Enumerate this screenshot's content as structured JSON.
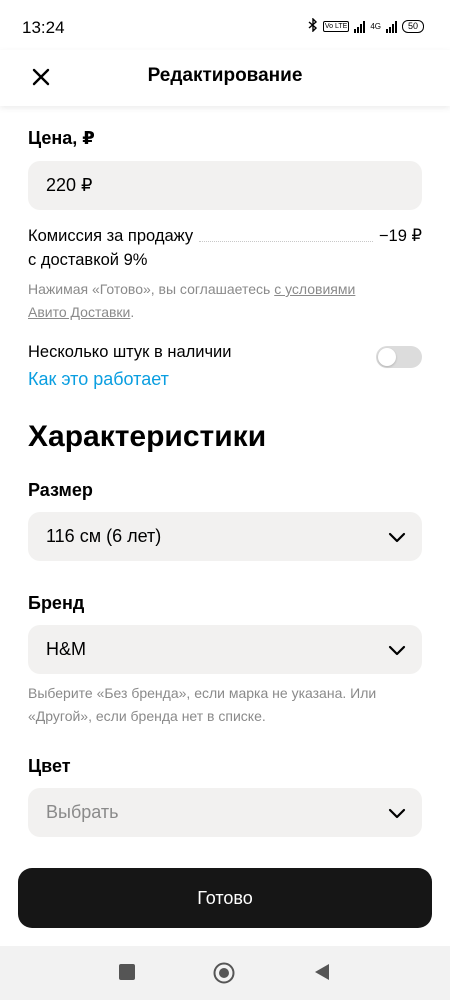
{
  "status_bar": {
    "time": "13:24",
    "lte_label": "Vo LTE",
    "network_label": "4G",
    "battery": "50"
  },
  "header": {
    "title": "Редактирование",
    "close_icon": "close-icon"
  },
  "price": {
    "label": "Цена, ₽",
    "value": "220 ₽"
  },
  "commission": {
    "label_line1": "Комиссия за продажу",
    "label_line2": "с доставкой 9%",
    "value": "−19 ₽"
  },
  "terms": {
    "prefix": "Нажимая «Готово», вы соглашаетесь ",
    "link1": "с условиями",
    "link2": "Авито Доставки",
    "suffix": "."
  },
  "multiple": {
    "label": "Несколько штук в наличии",
    "link": "Как это работает",
    "enabled": false
  },
  "characteristics": {
    "title": "Характеристики",
    "size": {
      "label": "Размер",
      "value": "116 см (6 лет)"
    },
    "brand": {
      "label": "Бренд",
      "value": "H&M",
      "hint": "Выберите «Без бренда», если марка не указана. Или «Другой», если бренда нет в списке."
    },
    "color": {
      "label": "Цвет",
      "placeholder": "Выбрать"
    }
  },
  "done_button": "Готово",
  "colors": {
    "accent_link": "#0a9ee0",
    "button_bg": "#161616",
    "field_bg": "#f2f1f0"
  },
  "nav": {
    "icons": [
      "square-recents-icon",
      "circle-home-icon",
      "triangle-back-icon"
    ]
  }
}
